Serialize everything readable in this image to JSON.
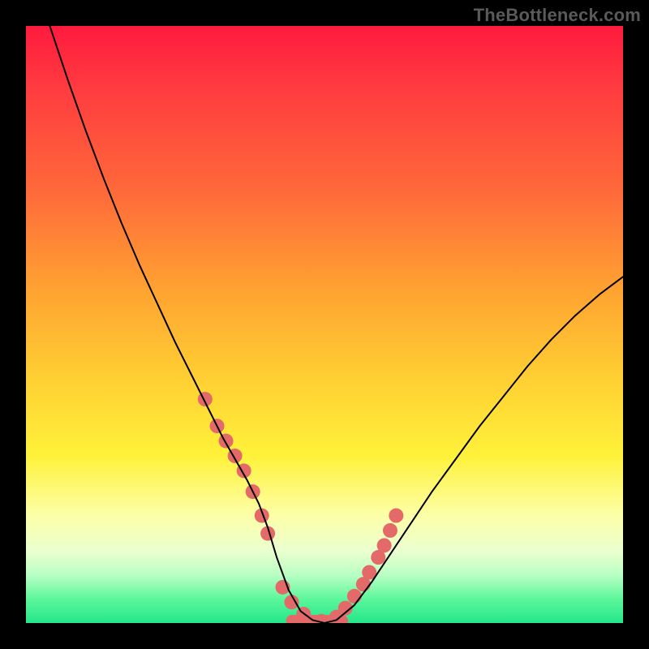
{
  "watermark": "TheBottleneck.com",
  "chart_data": {
    "type": "line",
    "title": "",
    "xlabel": "",
    "ylabel": "",
    "xlim": [
      0,
      100
    ],
    "ylim": [
      0,
      100
    ],
    "grid": false,
    "legend": false,
    "series": [
      {
        "name": "fit-curve",
        "color": "#000000",
        "stroke_width": 2,
        "x": [
          4,
          7,
          10,
          13,
          16,
          19,
          22,
          25,
          28,
          31,
          33,
          35,
          37,
          39,
          40.5,
          42,
          44,
          46,
          48,
          50,
          52,
          55,
          58,
          61,
          64,
          68,
          72,
          76,
          80,
          84,
          88,
          92,
          96,
          100
        ],
        "values": [
          100,
          91,
          82.5,
          74.5,
          67,
          60,
          53.5,
          47,
          41,
          35,
          31,
          27.5,
          24,
          20,
          16,
          11,
          5.5,
          2,
          0.5,
          0,
          0.5,
          3,
          7,
          11.5,
          16,
          22,
          27.5,
          33,
          38,
          43,
          47.5,
          51.5,
          55,
          58
        ]
      },
      {
        "name": "data-points",
        "color": "#e46a6a",
        "marker_radius": 9,
        "x": [
          30,
          32,
          33.5,
          35,
          36.5,
          38,
          39.5,
          40.5,
          43,
          44.5,
          46.5,
          49.5,
          52,
          53.5,
          55,
          56.5,
          57.5,
          59,
          60,
          61,
          62
        ],
        "values": [
          37.5,
          33,
          30.5,
          28,
          25.5,
          22,
          18,
          15,
          6,
          3.5,
          1.5,
          0.3,
          1,
          2.5,
          4.5,
          6.5,
          8.5,
          11,
          13,
          15.5,
          18
        ]
      },
      {
        "name": "flat-segment",
        "color": "#e46a6a",
        "stroke_width": 14,
        "x": [
          44.5,
          53
        ],
        "values": [
          0.4,
          0.4
        ]
      }
    ],
    "gradient_stops": [
      {
        "pos": 0,
        "color": "#ff1a3e"
      },
      {
        "pos": 10,
        "color": "#ff3a40"
      },
      {
        "pos": 28,
        "color": "#ff6a3a"
      },
      {
        "pos": 45,
        "color": "#ffa531"
      },
      {
        "pos": 60,
        "color": "#ffd233"
      },
      {
        "pos": 72,
        "color": "#fff23a"
      },
      {
        "pos": 82,
        "color": "#fdffa8"
      },
      {
        "pos": 88,
        "color": "#eaffcf"
      },
      {
        "pos": 92,
        "color": "#b8ffc4"
      },
      {
        "pos": 96,
        "color": "#5cf79c"
      },
      {
        "pos": 100,
        "color": "#24e68a"
      }
    ]
  }
}
